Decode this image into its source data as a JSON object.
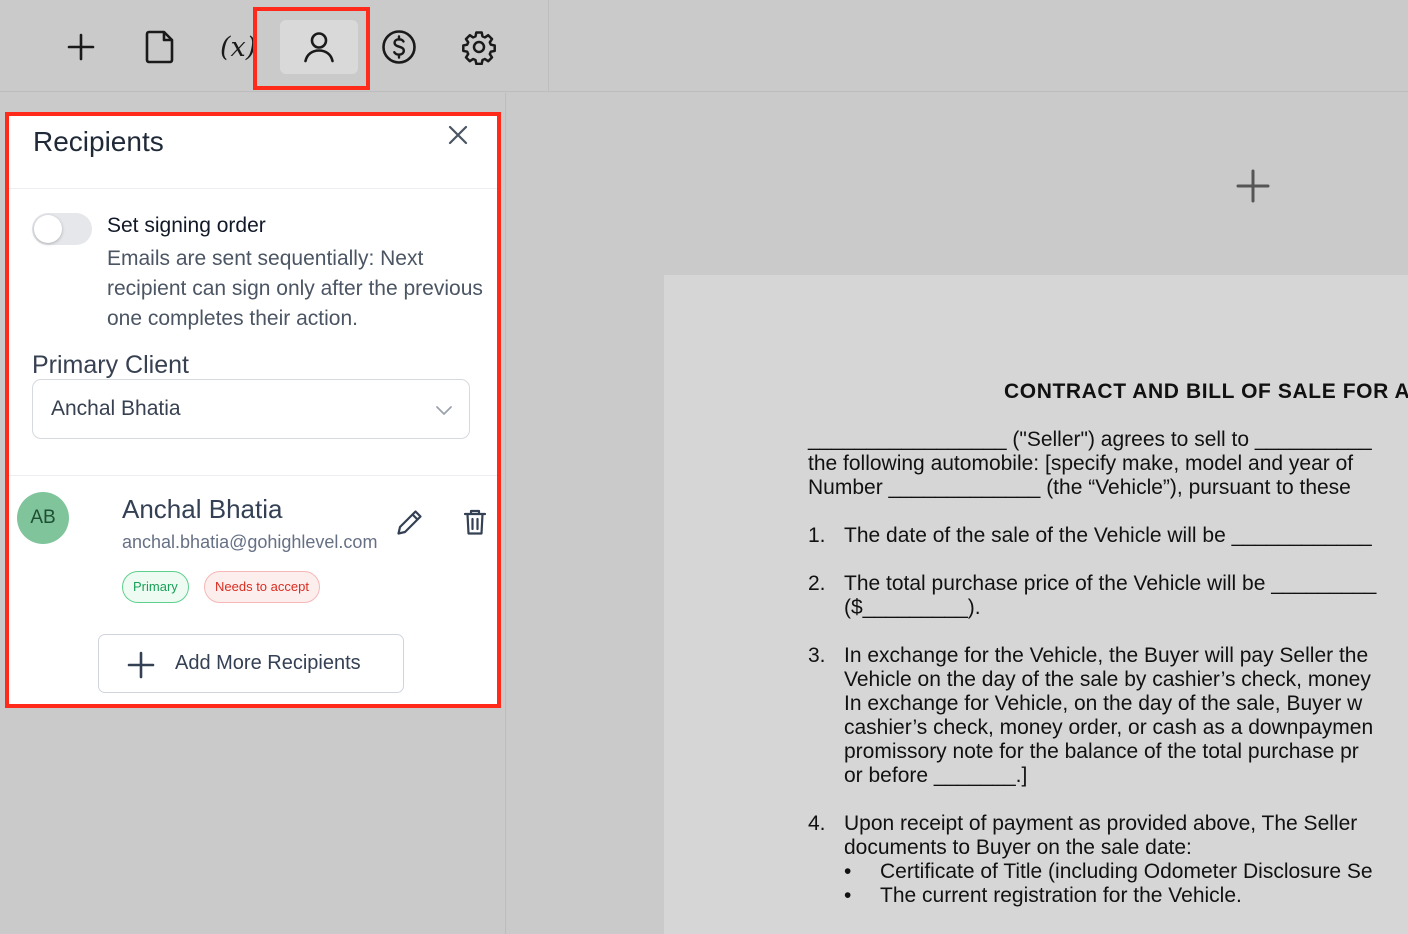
{
  "toolbar": {
    "variable_label": "(x)",
    "tools": [
      "add-icon",
      "document-icon",
      "variable-icon",
      "user-icon",
      "dollar-icon",
      "gear-icon"
    ]
  },
  "panel": {
    "title": "Recipients",
    "signing_order": {
      "title": "Set signing order",
      "description": "Emails are sent sequentially: Next recipient can sign only after the previous one completes their action.",
      "enabled": false
    },
    "primary_client": {
      "label": "Primary Client",
      "selected": "Anchal Bhatia"
    },
    "recipients": [
      {
        "initials": "AB",
        "name": "Anchal Bhatia",
        "email": "anchal.bhatia@gohighlevel.com",
        "badges": [
          "Primary",
          "Needs to accept"
        ]
      }
    ],
    "add_button_label": "Add More Recipients"
  },
  "document": {
    "title": "CONTRACT AND BILL OF SALE FOR A",
    "lines": [
      "_________________ (\"Seller\") agrees to sell to __________",
      "the following automobile: [specify make, model and year of",
      "Number _____________ (the “Vehicle”), pursuant to these"
    ],
    "items": [
      {
        "num": "1.",
        "lines": [
          "The date of the sale of the Vehicle will be ____________"
        ]
      },
      {
        "num": "2.",
        "lines": [
          "The total purchase price of the Vehicle will be _________",
          "($_________)."
        ]
      },
      {
        "num": "3.",
        "lines": [
          "In exchange for the Vehicle, the Buyer will pay Seller the",
          "Vehicle on the day of the sale by cashier’s check, money",
          "In exchange for Vehicle, on the day of the sale, Buyer w",
          "cashier’s check, money order, or cash as a downpaymen",
          "promissory note for the balance of the total purchase pr",
          "or before _______.]"
        ]
      },
      {
        "num": "4.",
        "lines": [
          "Upon receipt of payment as provided above, The Seller",
          "documents to Buyer on the sale date:"
        ],
        "bullets": [
          "Certificate of Title (including Odometer Disclosure Se",
          "The current registration for the Vehicle."
        ]
      }
    ],
    "bullet_char": "•"
  },
  "colors": {
    "highlight": "#ff2a1a",
    "avatar": "#7fc49b",
    "badge_primary": "#18a058",
    "badge_needs_accept": "#d92d20"
  }
}
